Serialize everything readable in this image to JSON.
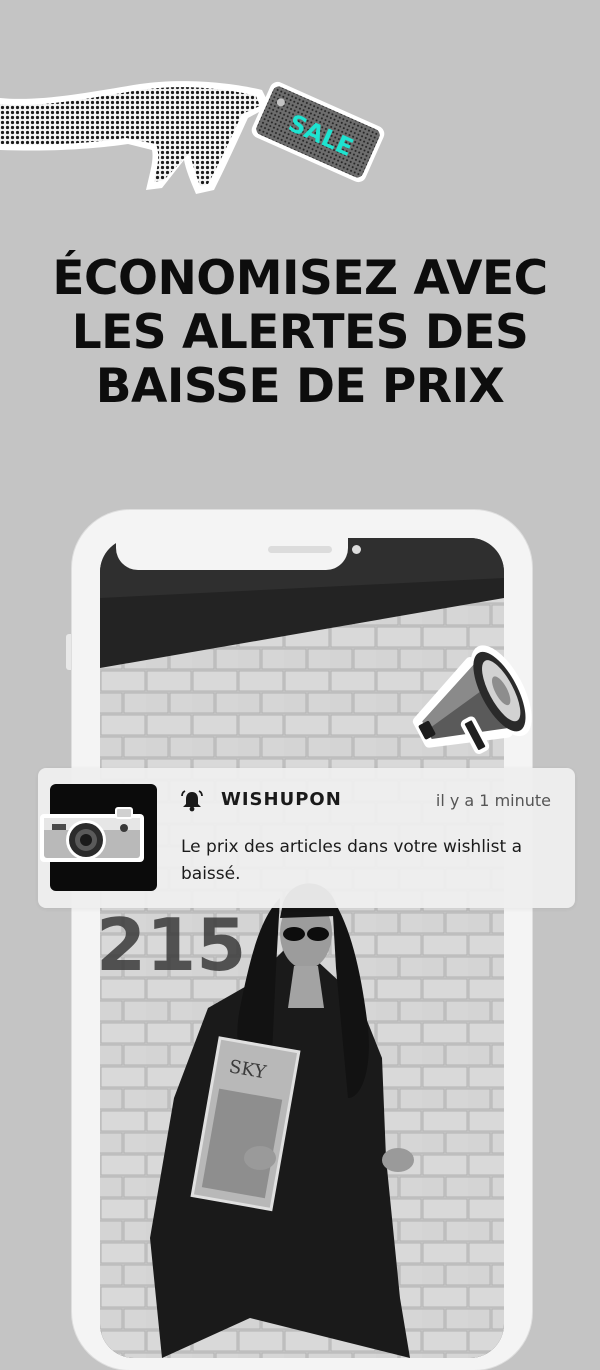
{
  "hero": {
    "sale_tag_text": "SALE",
    "sale_tag_color": "#1ee3d0"
  },
  "headline": {
    "line1": "ÉCONOMISEZ AVEC",
    "line2": "LES ALERTES DES",
    "line3": "BAISSE DE PRIX"
  },
  "notification": {
    "app_name": "WISHUPON",
    "time": "il y a 1 minute",
    "message": "Le prix des articles dans votre wishlist a baissé.",
    "icon": "bell-icon",
    "app_icon": "camera-icon"
  },
  "photo": {
    "wall_number": "215",
    "magazine_title": "SKY"
  }
}
